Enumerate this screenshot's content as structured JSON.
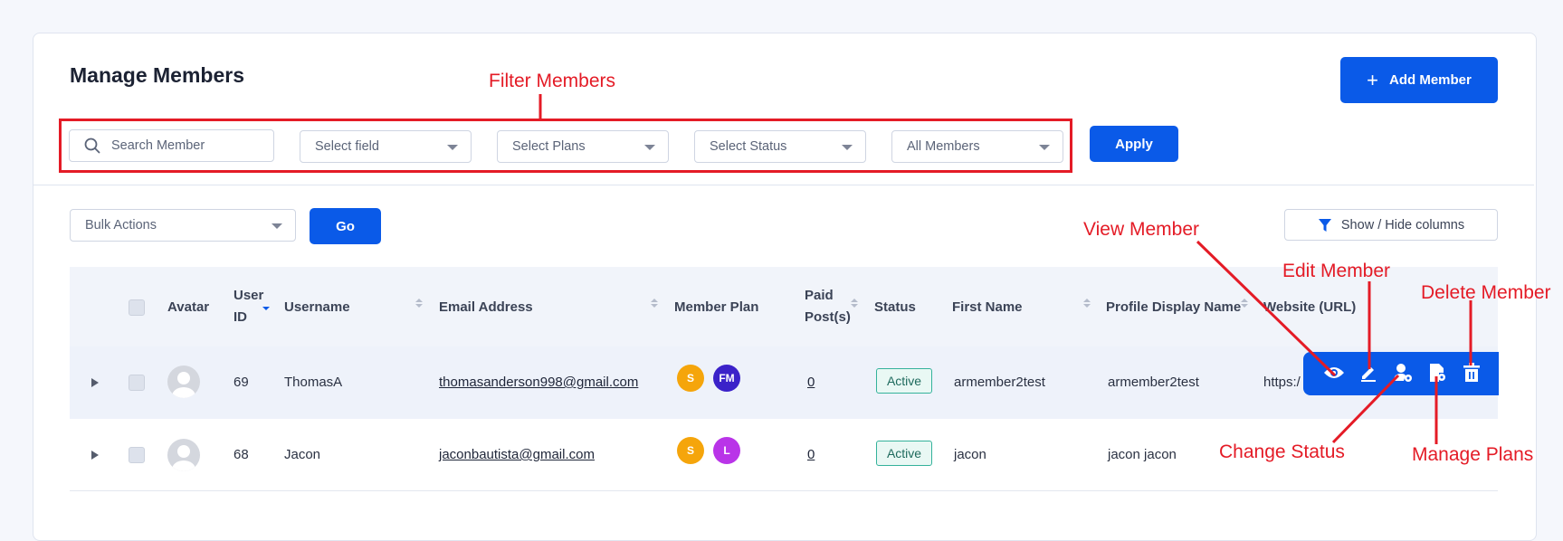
{
  "page": {
    "title": "Manage Members"
  },
  "header": {
    "add_member_label": "Add Member",
    "add_member_icon": "plus-icon"
  },
  "filters": {
    "search_placeholder": "Search Member",
    "select_field": "Select field",
    "select_plans": "Select Plans",
    "select_status": "Select Status",
    "all_members": "All Members",
    "apply_label": "Apply"
  },
  "bulk": {
    "label": "Bulk Actions",
    "go_label": "Go"
  },
  "columns_button": {
    "label": "Show / Hide columns",
    "icon": "filter-funnel-icon"
  },
  "table": {
    "headers": {
      "avatar": "Avatar",
      "user_id_1": "User",
      "user_id_2": "ID",
      "username": "Username",
      "email": "Email Address",
      "member_plan": "Member Plan",
      "paid_posts_1": "Paid",
      "paid_posts_2": "Post(s)",
      "status": "Status",
      "first_name": "First Name",
      "profile_display_name": "Profile Display Name",
      "website": "Website (URL)"
    },
    "rows": [
      {
        "id": "69",
        "username": "ThomasA",
        "email": "thomasanderson998@gmail.com",
        "plans": [
          {
            "abbr": "S",
            "color": "#f5a50b"
          },
          {
            "abbr": "FM",
            "color": "#3b22c9"
          }
        ],
        "paid_posts": "0",
        "status": "Active",
        "first_name": "armember2test",
        "display_name": "armember2test",
        "website": "https:/"
      },
      {
        "id": "68",
        "username": "Jacon",
        "email": "jaconbautista@gmail.com",
        "plans": [
          {
            "abbr": "S",
            "color": "#f5a50b"
          },
          {
            "abbr": "L",
            "color": "#b934e8"
          }
        ],
        "paid_posts": "0",
        "status": "Active",
        "first_name": "jacon",
        "display_name": "jacon jacon",
        "website": ""
      }
    ]
  },
  "row_actions": [
    "view-icon",
    "edit-icon",
    "change-status-icon",
    "manage-plans-icon",
    "delete-icon"
  ],
  "annotations": {
    "filter_members": "Filter Members",
    "view_member": "View Member",
    "edit_member": "Edit Member",
    "delete_member": "Delete Member",
    "change_status": "Change Status",
    "manage_plans": "Manage Plans",
    "color": "#e41b26"
  },
  "colors": {
    "primary": "#0a5ae8",
    "status_active": "#34b29b"
  }
}
